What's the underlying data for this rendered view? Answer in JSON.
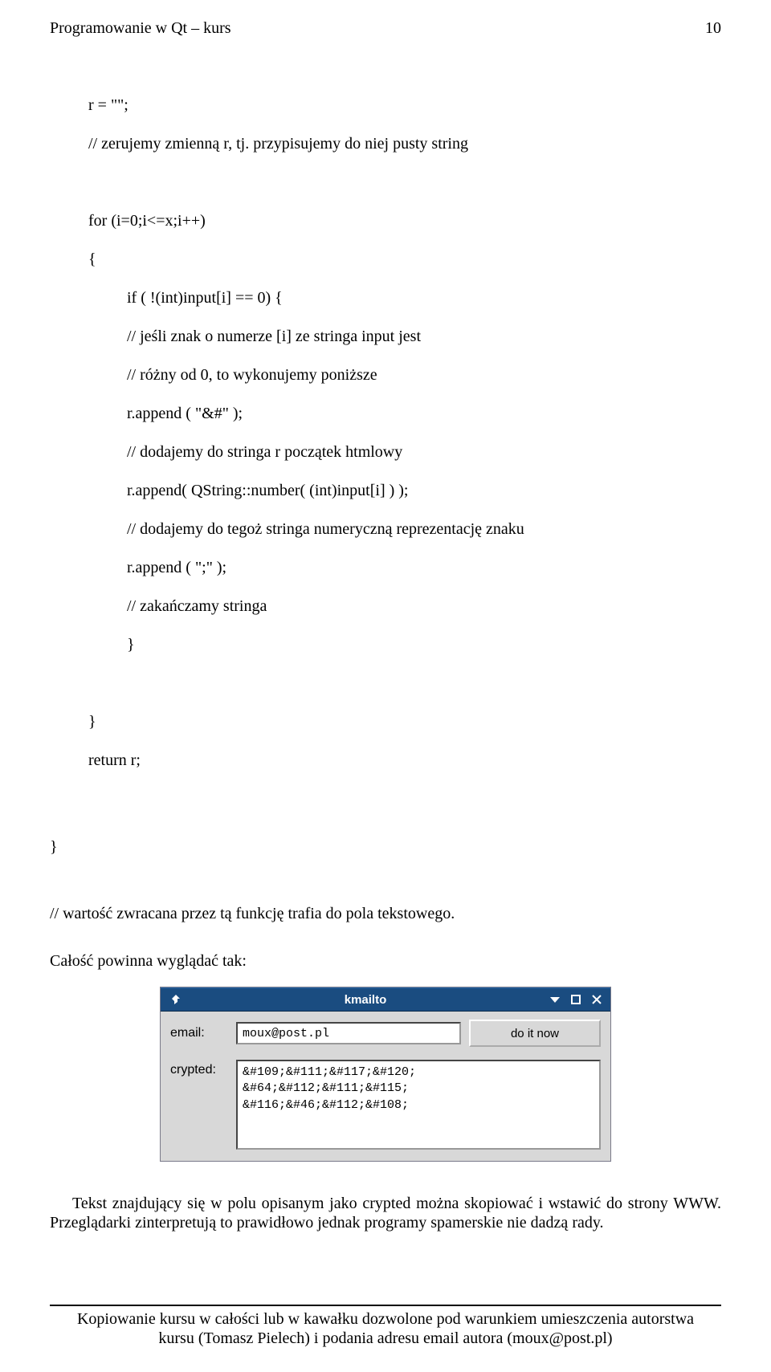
{
  "header": {
    "title": "Programowanie w Qt – kurs",
    "page_number": "10"
  },
  "code": {
    "line1": "r = \"\";",
    "line2": "// zerujemy zmienną r, tj. przypisujemy do niej pusty string",
    "line3": "for (i=0;i<=x;i++)",
    "line4": "{",
    "line5": "if ( !(int)input[i] == 0) {",
    "line6": "// jeśli znak o numerze [i] ze stringa input jest",
    "line7": "// różny od 0, to wykonujemy poniższe",
    "line8": "r.append ( \"&#\" );",
    "line9": "// dodajemy do stringa r początek htmlowy",
    "line10": "r.append( QString::number( (int)input[i] ) );",
    "line11": "// dodajemy do tegoż stringa numeryczną reprezentację znaku",
    "line12": "r.append ( \";\" );",
    "line13": "// zakańczamy stringa",
    "line14": "}",
    "line15": "}",
    "line16": "return r;",
    "line17": "}",
    "comment_end": "// wartość zwracana przez tą funkcję trafia do pola tekstowego."
  },
  "section_label": "Całość powinna wyglądać tak:",
  "window": {
    "title": "kmailto",
    "email_label": "email:",
    "email_value": "moux@post.pl",
    "button_label": "do it now",
    "crypted_label": "crypted:",
    "crypted_value": "&#109;&#111;&#117;&#120;\n&#64;&#112;&#111;&#115;\n&#116;&#46;&#112;&#108;"
  },
  "paragraph": "Tekst znajdujący się w polu opisanym jako crypted można skopiować i wstawić do strony WWW. Przeglądarki zinterpretują to prawidłowo jednak programy spamerskie nie dadzą rady.",
  "footer": {
    "line1": "Kopiowanie kursu w całości lub w kawałku dozwolone pod warunkiem umieszczenia autorstwa",
    "line2": "kursu (Tomasz Pielech) i podania adresu email autora (moux@post.pl)"
  }
}
